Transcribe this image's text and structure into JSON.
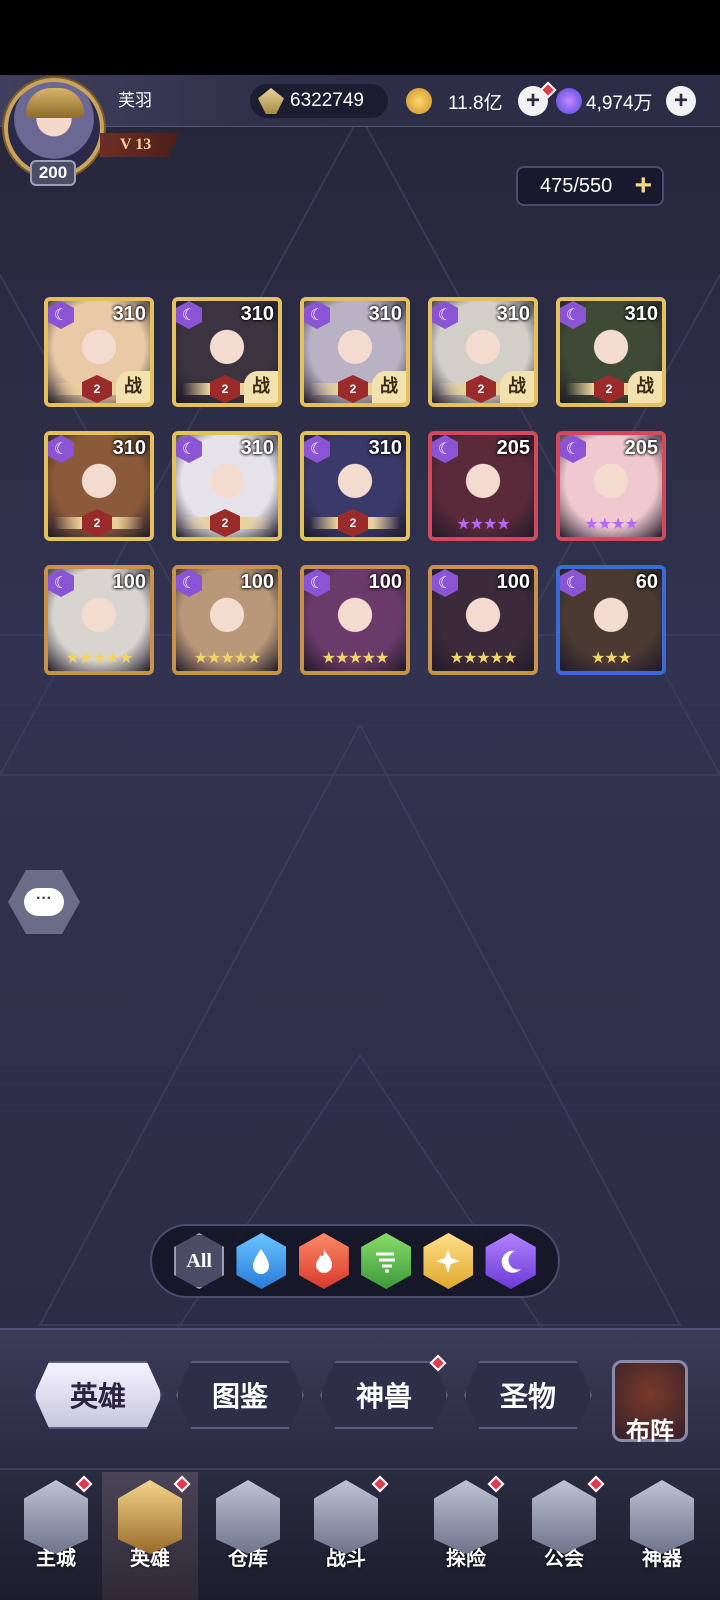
{
  "player": {
    "name": "芙羽",
    "level": "200",
    "vip": "V 13"
  },
  "resources": {
    "gems": "6322749",
    "gold": "11.8亿",
    "crystals": "4,974万",
    "plus": "+"
  },
  "capacity": {
    "text": "475/550",
    "plus": "+"
  },
  "heroes": [
    {
      "level": "310",
      "stars": "",
      "badge": "战",
      "rank": "2",
      "frame": "gold",
      "tint": "#e9c9a6"
    },
    {
      "level": "310",
      "stars": "",
      "badge": "战",
      "rank": "2",
      "frame": "gold",
      "tint": "#3b3440"
    },
    {
      "level": "310",
      "stars": "",
      "badge": "战",
      "rank": "2",
      "frame": "gold",
      "tint": "#b9b2c4"
    },
    {
      "level": "310",
      "stars": "",
      "badge": "战",
      "rank": "2",
      "frame": "gold",
      "tint": "#d2cfc9"
    },
    {
      "level": "310",
      "stars": "",
      "badge": "战",
      "rank": "2",
      "frame": "gold",
      "tint": "#3f4a36"
    },
    {
      "level": "310",
      "stars": "",
      "badge": "",
      "rank": "2",
      "frame": "gold",
      "tint": "#8a5a3a"
    },
    {
      "level": "310",
      "stars": "",
      "badge": "",
      "rank": "2",
      "frame": "gold",
      "tint": "#e6e2ea"
    },
    {
      "level": "310",
      "stars": "",
      "badge": "",
      "rank": "2",
      "frame": "gold",
      "tint": "#3a3a6a"
    },
    {
      "level": "205",
      "stars": "★★★★",
      "badge": "",
      "rank": "",
      "frame": "red",
      "tint": "#5a2a3a"
    },
    {
      "level": "205",
      "stars": "★★★★",
      "badge": "",
      "rank": "",
      "frame": "red",
      "tint": "#f0c8d0"
    },
    {
      "level": "100",
      "stars": "★★★★★",
      "badge": "",
      "rank": "",
      "frame": "bronze",
      "tint": "#d8d4d0"
    },
    {
      "level": "100",
      "stars": "★★★★★",
      "badge": "",
      "rank": "",
      "frame": "bronze",
      "tint": "#b89878"
    },
    {
      "level": "100",
      "stars": "★★★★★",
      "badge": "",
      "rank": "",
      "frame": "bronze",
      "tint": "#6a3a6a"
    },
    {
      "level": "100",
      "stars": "★★★★★",
      "badge": "",
      "rank": "",
      "frame": "bronze",
      "tint": "#3a2a3a"
    },
    {
      "level": "60",
      "stars": "★★★",
      "badge": "",
      "rank": "",
      "frame": "blue",
      "tint": "#4a3a32"
    }
  ],
  "frameColors": {
    "gold": "#e4c15c",
    "red": "#d04a5a",
    "bronze": "#c8924a",
    "blue": "#3a6ad8"
  },
  "starColors": {
    "gold": "#f1d36a",
    "red": "#b768ff",
    "bronze": "#f1d36a",
    "blue": "#f1d36a"
  },
  "filters": {
    "all": "All"
  },
  "tabs": {
    "hero": "英雄",
    "atlas": "图鉴",
    "beast": "神兽",
    "relic": "圣物",
    "formation": "布阵"
  },
  "nav": {
    "city": "主城",
    "hero": "英雄",
    "storage": "仓库",
    "battle": "战斗",
    "explore": "探险",
    "guild": "公会",
    "artifact": "神器"
  },
  "chat": {
    "text": "···"
  },
  "colors": {
    "accent": "#8a54d4",
    "notify": "#e23a4e"
  }
}
